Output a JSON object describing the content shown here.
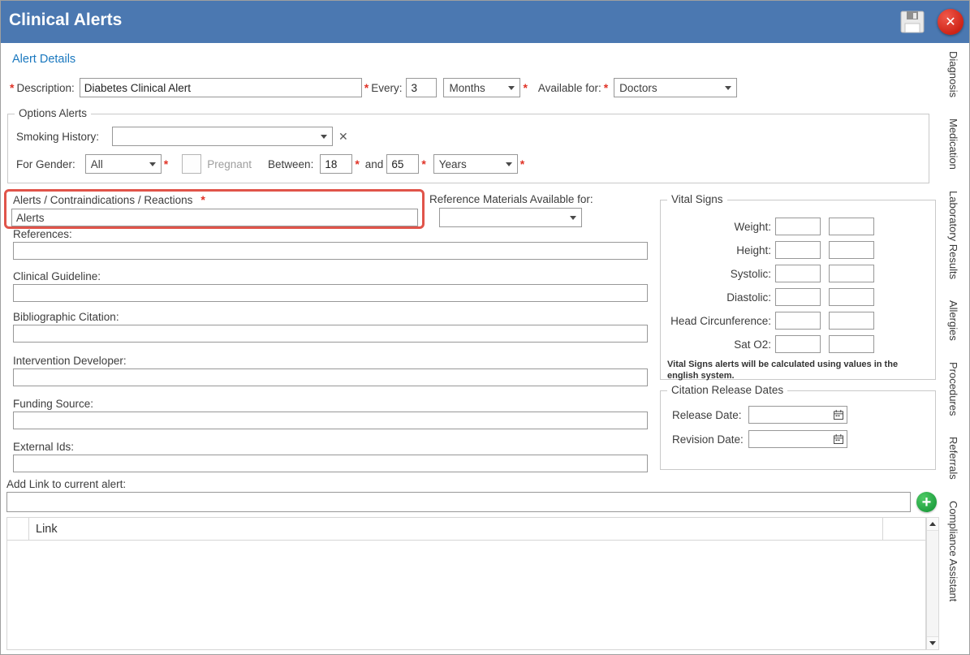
{
  "icons": {
    "close_glyph": "✕",
    "clear_glyph": "✕",
    "add_glyph": "+",
    "required_glyph": "*"
  },
  "titlebar": {
    "title": "Clinical Alerts"
  },
  "side_tabs": [
    "Diagnosis",
    "Medication",
    "Laboratory Results",
    "Allergies",
    "Procedures",
    "Referrals",
    "Compliance Assistant"
  ],
  "alert_details_link": "Alert Details",
  "description_row": {
    "description_label": "Description:",
    "description_value": "Diabetes Clinical Alert",
    "every_label": "Every:",
    "every_value": "3",
    "every_unit_value": "Months",
    "available_for_label": "Available for:",
    "available_for_value": "Doctors"
  },
  "options_alerts": {
    "legend": "Options Alerts",
    "smoking_history_label": "Smoking History:",
    "smoking_history_value": "",
    "for_gender_label": "For Gender:",
    "for_gender_value": "All",
    "pregnant_label": "Pregnant",
    "pregnant_checked": false,
    "between_label": "Between:",
    "between_min_value": "18",
    "and_label": "and",
    "between_max_value": "65",
    "between_unit_value": "Years"
  },
  "alerts_box": {
    "label": "Alerts / Contraindications / Reactions",
    "value": "Alerts"
  },
  "reference_materials": {
    "label": "Reference Materials Available for:",
    "value": ""
  },
  "detail_fields": [
    {
      "label": "References:",
      "value": ""
    },
    {
      "label": "Clinical Guideline:",
      "value": ""
    },
    {
      "label": "Bibliographic Citation:",
      "value": ""
    },
    {
      "label": "Intervention Developer:",
      "value": ""
    },
    {
      "label": "Funding Source:",
      "value": ""
    },
    {
      "label": "External Ids:",
      "value": ""
    }
  ],
  "vital_signs": {
    "legend": "Vital Signs",
    "rows": [
      {
        "label": "Weight:",
        "min": "",
        "max": ""
      },
      {
        "label": "Height:",
        "min": "",
        "max": ""
      },
      {
        "label": "Systolic:",
        "min": "",
        "max": ""
      },
      {
        "label": "Diastolic:",
        "min": "",
        "max": ""
      },
      {
        "label": "Head Circunference:",
        "min": "",
        "max": ""
      },
      {
        "label": "Sat O2:",
        "min": "",
        "max": ""
      }
    ],
    "note": "Vital Signs alerts will be calculated using values in the english system."
  },
  "citation_release_dates": {
    "legend": "Citation Release Dates",
    "release_date_label": "Release Date:",
    "release_date_value": "",
    "revision_date_label": "Revision Date:",
    "revision_date_value": ""
  },
  "add_link": {
    "label": "Add Link to current alert:",
    "value": ""
  },
  "links_table": {
    "header": "Link",
    "rows": []
  }
}
